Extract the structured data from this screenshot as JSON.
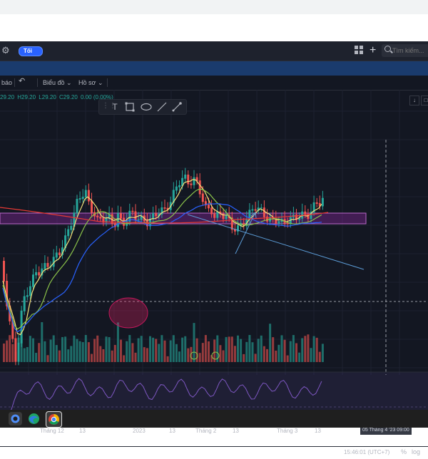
{
  "toolbar": {
    "theme_label": "Tối",
    "search_placeholder": "Tìm kiếm..."
  },
  "chart_toolbar": {
    "alert_label": "báo",
    "undo_symbol": "↶",
    "chart_menu": "Biểu đồ",
    "profile_menu": "Hồ sơ"
  },
  "legend": {
    "open": "29.20",
    "high": "H29.20",
    "low": "L29.20",
    "close": "C29.20",
    "change": "0.00 (0.00%)"
  },
  "drawing_tools": [
    "T-text",
    "rectangle",
    "ellipse",
    "line",
    "brush"
  ],
  "x_axis": {
    "labels": [
      "Tháng 12",
      "13",
      "2023",
      "13",
      "Tháng 2",
      "13",
      "Tháng 3",
      "13"
    ],
    "crosshair_label": "05 Tháng 4 '23   09:00"
  },
  "status": {
    "time": "15:46:01 (UTC+7)",
    "percent": "%",
    "log": "log"
  },
  "colors": {
    "background": "#131722",
    "up": "#26a69a",
    "down": "#ef5350",
    "rsi": "#7e57c2",
    "accent": "#2962ff"
  },
  "taskbar": {
    "apps": [
      "windows-icon",
      "edge-icon",
      "chrome-icon"
    ]
  }
}
